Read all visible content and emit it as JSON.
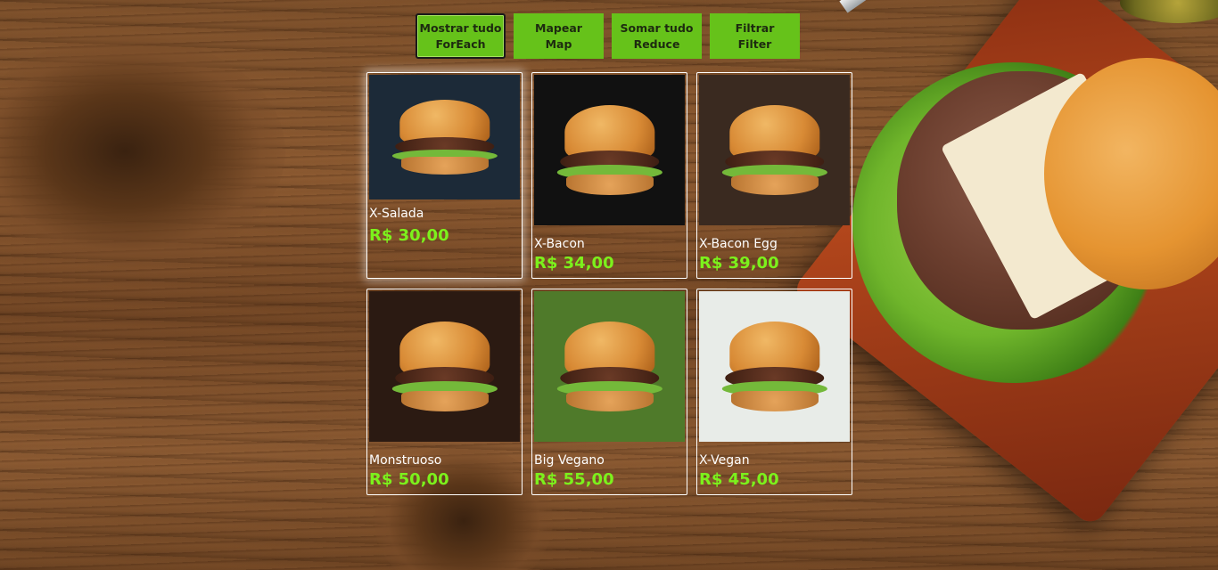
{
  "toolbar": {
    "buttons": [
      {
        "line1": "Mostrar tudo",
        "line2": "ForEach"
      },
      {
        "line1": "Mapear",
        "line2": "Map"
      },
      {
        "line1": "Somar tudo",
        "line2": "Reduce"
      },
      {
        "line1": "Filtrar",
        "line2": "Filter"
      }
    ]
  },
  "menu": {
    "items": [
      {
        "name": "X-Salada",
        "price": "R$ 30,00",
        "photo_bg": "#1c2a38"
      },
      {
        "name": "X-Bacon",
        "price": "R$ 34,00",
        "photo_bg": "#111111"
      },
      {
        "name": "X-Bacon Egg",
        "price": "R$ 39,00",
        "photo_bg": "#3a2a20"
      },
      {
        "name": "Monstruoso",
        "price": "R$ 50,00",
        "photo_bg": "#2b1a12"
      },
      {
        "name": "Big Vegano",
        "price": "R$ 55,00",
        "photo_bg": "#4f7a2a"
      },
      {
        "name": "X-Vegan",
        "price": "R$ 45,00",
        "photo_bg": "#e8ece8"
      }
    ]
  },
  "colors": {
    "button_bg": "#66c21a",
    "price_text": "#7cf11c",
    "card_border": "#ffffff"
  }
}
